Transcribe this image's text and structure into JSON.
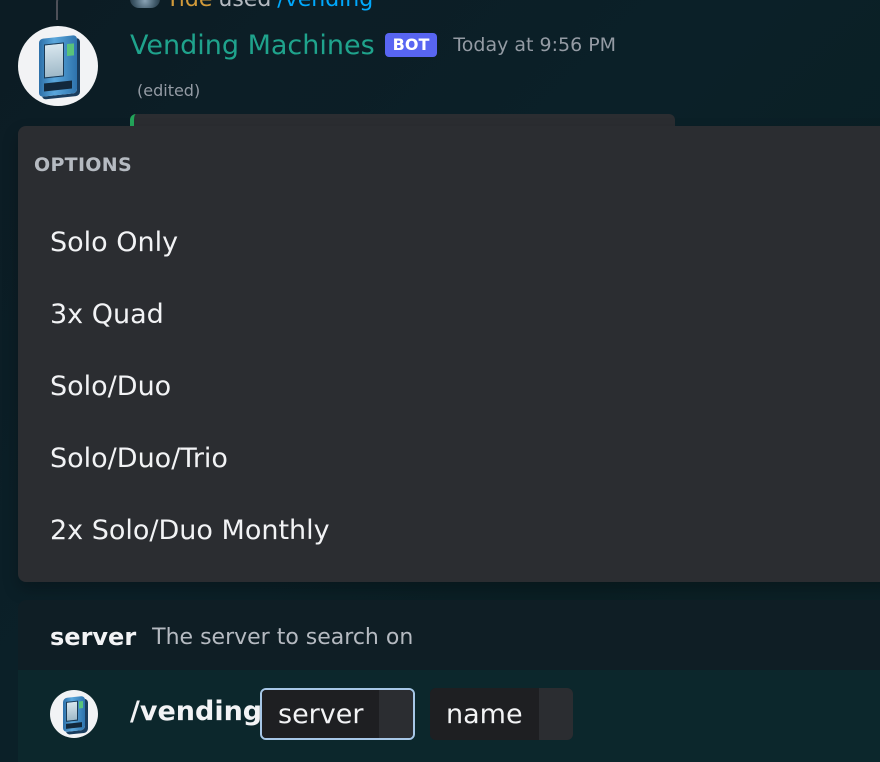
{
  "message": {
    "reply": {
      "username": "Tide",
      "used_text": "used",
      "command": "/vending"
    },
    "author": {
      "name": "Vending Machines",
      "badge": "BOT",
      "timestamp": "Today at 9:56 PM"
    },
    "edited_label": "(edited)"
  },
  "options_popup": {
    "header": "OPTIONS",
    "items": [
      {
        "label": "Solo Only"
      },
      {
        "label": "3x Quad"
      },
      {
        "label": "Solo/Duo"
      },
      {
        "label": "Solo/Duo/Trio"
      },
      {
        "label": "2x Solo/Duo Monthly"
      }
    ]
  },
  "command_hint": {
    "param_name": "server",
    "param_description": "The server to search on"
  },
  "command_input": {
    "command": "/vending",
    "params": [
      {
        "label": "server",
        "active": true
      },
      {
        "label": "name",
        "active": false
      }
    ]
  },
  "colors": {
    "bot_name": "#1fa38c",
    "bot_badge": "#5865f2",
    "reply_username": "#d29a3a",
    "reply_command": "#00a8fc",
    "active_param_border": "#a7c7e7"
  }
}
